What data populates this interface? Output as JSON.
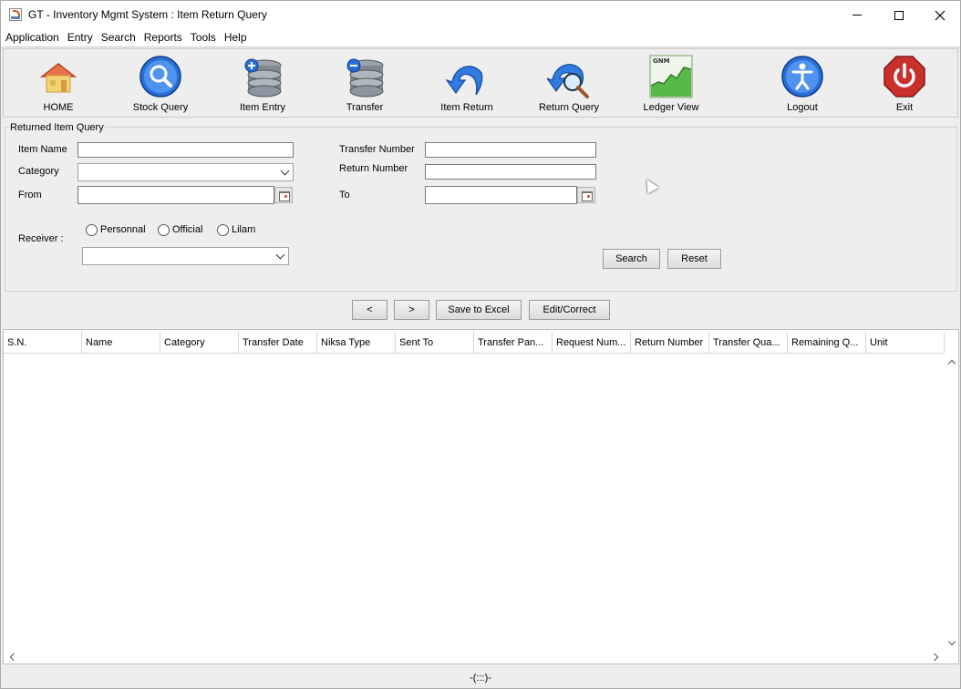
{
  "window": {
    "title": "GT - Inventory Mgmt System : Item Return Query"
  },
  "menu": [
    "Application",
    "Entry",
    "Search",
    "Reports",
    "Tools",
    "Help"
  ],
  "toolbar": [
    {
      "label": "HOME",
      "icon": "home-icon"
    },
    {
      "label": "Stock Query",
      "icon": "magnifier-icon"
    },
    {
      "label": "Item Entry",
      "icon": "database-add-icon"
    },
    {
      "label": "Transfer",
      "icon": "database-remove-icon"
    },
    {
      "label": "Item Return",
      "icon": "return-arrow-icon"
    },
    {
      "label": "Return Query",
      "icon": "return-search-icon"
    },
    {
      "label": "Ledger View",
      "icon": "ledger-chart-icon",
      "badge": "GNM"
    },
    {
      "label": "Logout",
      "icon": "logout-person-icon"
    },
    {
      "label": "Exit",
      "icon": "power-icon"
    }
  ],
  "query": {
    "panel_title": "Returned Item Query",
    "item_name_label": "Item Name",
    "category_label": "Category",
    "from_label": "From",
    "transfer_number_label": "Transfer Number",
    "return_number_label": "Return Number",
    "to_label": "To",
    "receiver_label": "Receiver :",
    "receiver_options": [
      "Personnal",
      "Official",
      "Lilam"
    ],
    "search_label": "Search",
    "reset_label": "Reset"
  },
  "actions": {
    "prev_label": "<",
    "next_label": ">",
    "save_excel_label": "Save to Excel",
    "edit_label": "Edit/Correct"
  },
  "table": {
    "columns": [
      "S.N.",
      "Name",
      "Category",
      "Transfer Date",
      "Niksa Type",
      "Sent To",
      "Transfer Pan...",
      "Request Num...",
      "Return Number",
      "Transfer Qua...",
      "Remaining Q...",
      "Unit"
    ]
  },
  "status": {
    "text": "-(:::)-"
  },
  "colors": {
    "window_bg": "#eeeeee",
    "table_bg": "#ffffff",
    "accent_blue": "#1f63c9"
  }
}
